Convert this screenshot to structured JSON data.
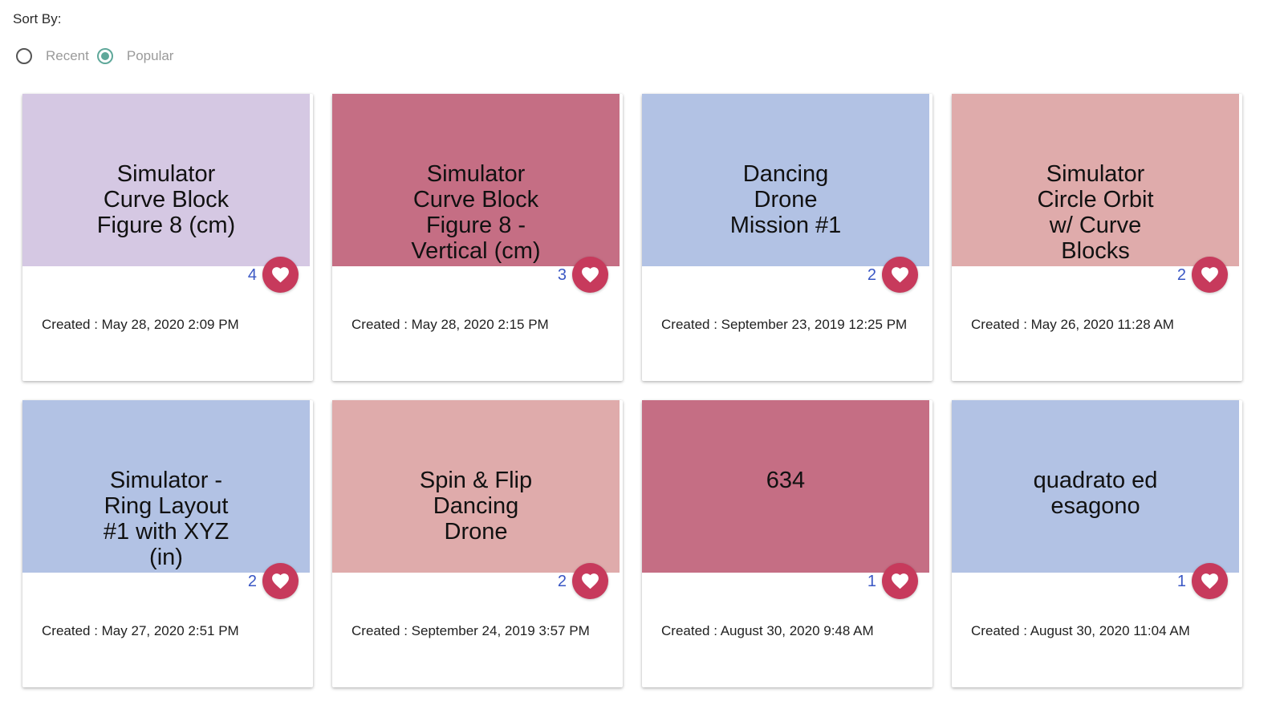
{
  "sort": {
    "label": "Sort By:",
    "options": [
      {
        "label": "Recent",
        "selected": false
      },
      {
        "label": "Popular",
        "selected": true
      }
    ],
    "accent_color": "#5fa89a"
  },
  "heart_color": "#c73a5c",
  "like_count_color": "#3a57c4",
  "cards": [
    {
      "title": "Simulator Curve Block Figure 8 (cm)",
      "likes": "4",
      "created": "Created : May 28, 2020 2:09 PM",
      "color": "#d5c8e3"
    },
    {
      "title": "Simulator Curve Block Figure 8 - Vertical (cm)",
      "likes": "3",
      "created": "Created : May 28, 2020 2:15 PM",
      "color": "#c56e84"
    },
    {
      "title": "Dancing Drone Mission #1",
      "likes": "2",
      "created": "Created : September 23, 2019 12:25 PM",
      "color": "#b2c2e4"
    },
    {
      "title": "Simulator Circle Orbit w/ Curve Blocks",
      "likes": "2",
      "created": "Created : May 26, 2020 11:28 AM",
      "color": "#dfabab"
    },
    {
      "title": "Simulator - Ring Layout #1 with XYZ (in)",
      "likes": "2",
      "created": "Created : May 27, 2020 2:51 PM",
      "color": "#b2c2e4"
    },
    {
      "title": "Spin & Flip Dancing Drone",
      "likes": "2",
      "created": "Created : September 24, 2019 3:57 PM",
      "color": "#dfabab"
    },
    {
      "title": "634",
      "likes": "1",
      "created": "Created : August 30, 2020 9:48 AM",
      "color": "#c56e84"
    },
    {
      "title": "quadrato ed esagono",
      "likes": "1",
      "created": "Created : August 30, 2020 11:04 AM",
      "color": "#b2c2e4"
    }
  ]
}
